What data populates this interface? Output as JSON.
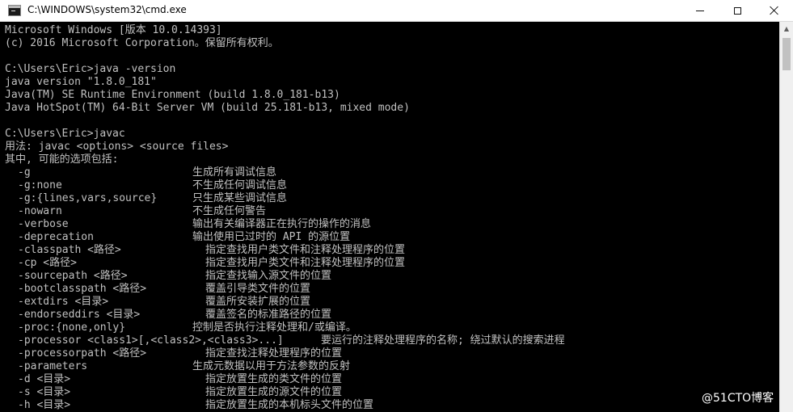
{
  "window": {
    "title": "C:\\WINDOWS\\system32\\cmd.exe",
    "app_icon": "console-icon",
    "controls": {
      "minimize": "minimize-icon",
      "maximize": "maximize-icon",
      "close": "close-icon"
    }
  },
  "console": {
    "header_lines": [
      "Microsoft Windows [版本 10.0.14393]",
      "(c) 2016 Microsoft Corporation。保留所有权利。",
      "",
      "C:\\Users\\Eric>java -version",
      "java version \"1.8.0_181\"",
      "Java(TM) SE Runtime Environment (build 1.8.0_181-b13)",
      "Java HotSpot(TM) 64-Bit Server VM (build 25.181-b13, mixed mode)",
      "",
      "C:\\Users\\Eric>javac",
      "用法: javac <options> <source files>",
      "其中, 可能的选项包括:"
    ],
    "options": [
      {
        "flag": "-g",
        "desc": "生成所有调试信息"
      },
      {
        "flag": "-g:none",
        "desc": "不生成任何调试信息"
      },
      {
        "flag": "-g:{lines,vars,source}",
        "desc": "只生成某些调试信息"
      },
      {
        "flag": "-nowarn",
        "desc": "不生成任何警告"
      },
      {
        "flag": "-verbose",
        "desc": "输出有关编译器正在执行的操作的消息"
      },
      {
        "flag": "-deprecation",
        "desc": "输出使用已过时的 API 的源位置"
      },
      {
        "flag": "-classpath <路径>",
        "desc": "指定查找用户类文件和注释处理程序的位置"
      },
      {
        "flag": "-cp <路径>",
        "desc": "指定查找用户类文件和注释处理程序的位置"
      },
      {
        "flag": "-sourcepath <路径>",
        "desc": "指定查找输入源文件的位置"
      },
      {
        "flag": "-bootclasspath <路径>",
        "desc": "覆盖引导类文件的位置"
      },
      {
        "flag": "-extdirs <目录>",
        "desc": "覆盖所安装扩展的位置"
      },
      {
        "flag": "-endorseddirs <目录>",
        "desc": "覆盖签名的标准路径的位置"
      },
      {
        "flag": "-proc:{none,only}",
        "desc": "控制是否执行注释处理和/或编译。"
      },
      {
        "flag": "-processor <class1>[,<class2>,<class3>...]",
        "desc": "要运行的注释处理程序的名称; 绕过默认的搜索进程"
      },
      {
        "flag": "-processorpath <路径>",
        "desc": "指定查找注释处理程序的位置"
      },
      {
        "flag": "-parameters",
        "desc": "生成元数据以用于方法参数的反射"
      },
      {
        "flag": "-d <目录>",
        "desc": "指定放置生成的类文件的位置"
      },
      {
        "flag": "-s <目录>",
        "desc": "指定放置生成的源文件的位置"
      },
      {
        "flag": "-h <目录>",
        "desc": "指定放置生成的本机标头文件的位置"
      }
    ]
  },
  "scrollbar": {
    "up_arrow": "scroll-up-arrow-icon"
  },
  "watermark": "@51CTO博客",
  "colors": {
    "console_bg": "#000000",
    "console_text": "#c0c0c0",
    "titlebar_bg": "#ffffff"
  }
}
